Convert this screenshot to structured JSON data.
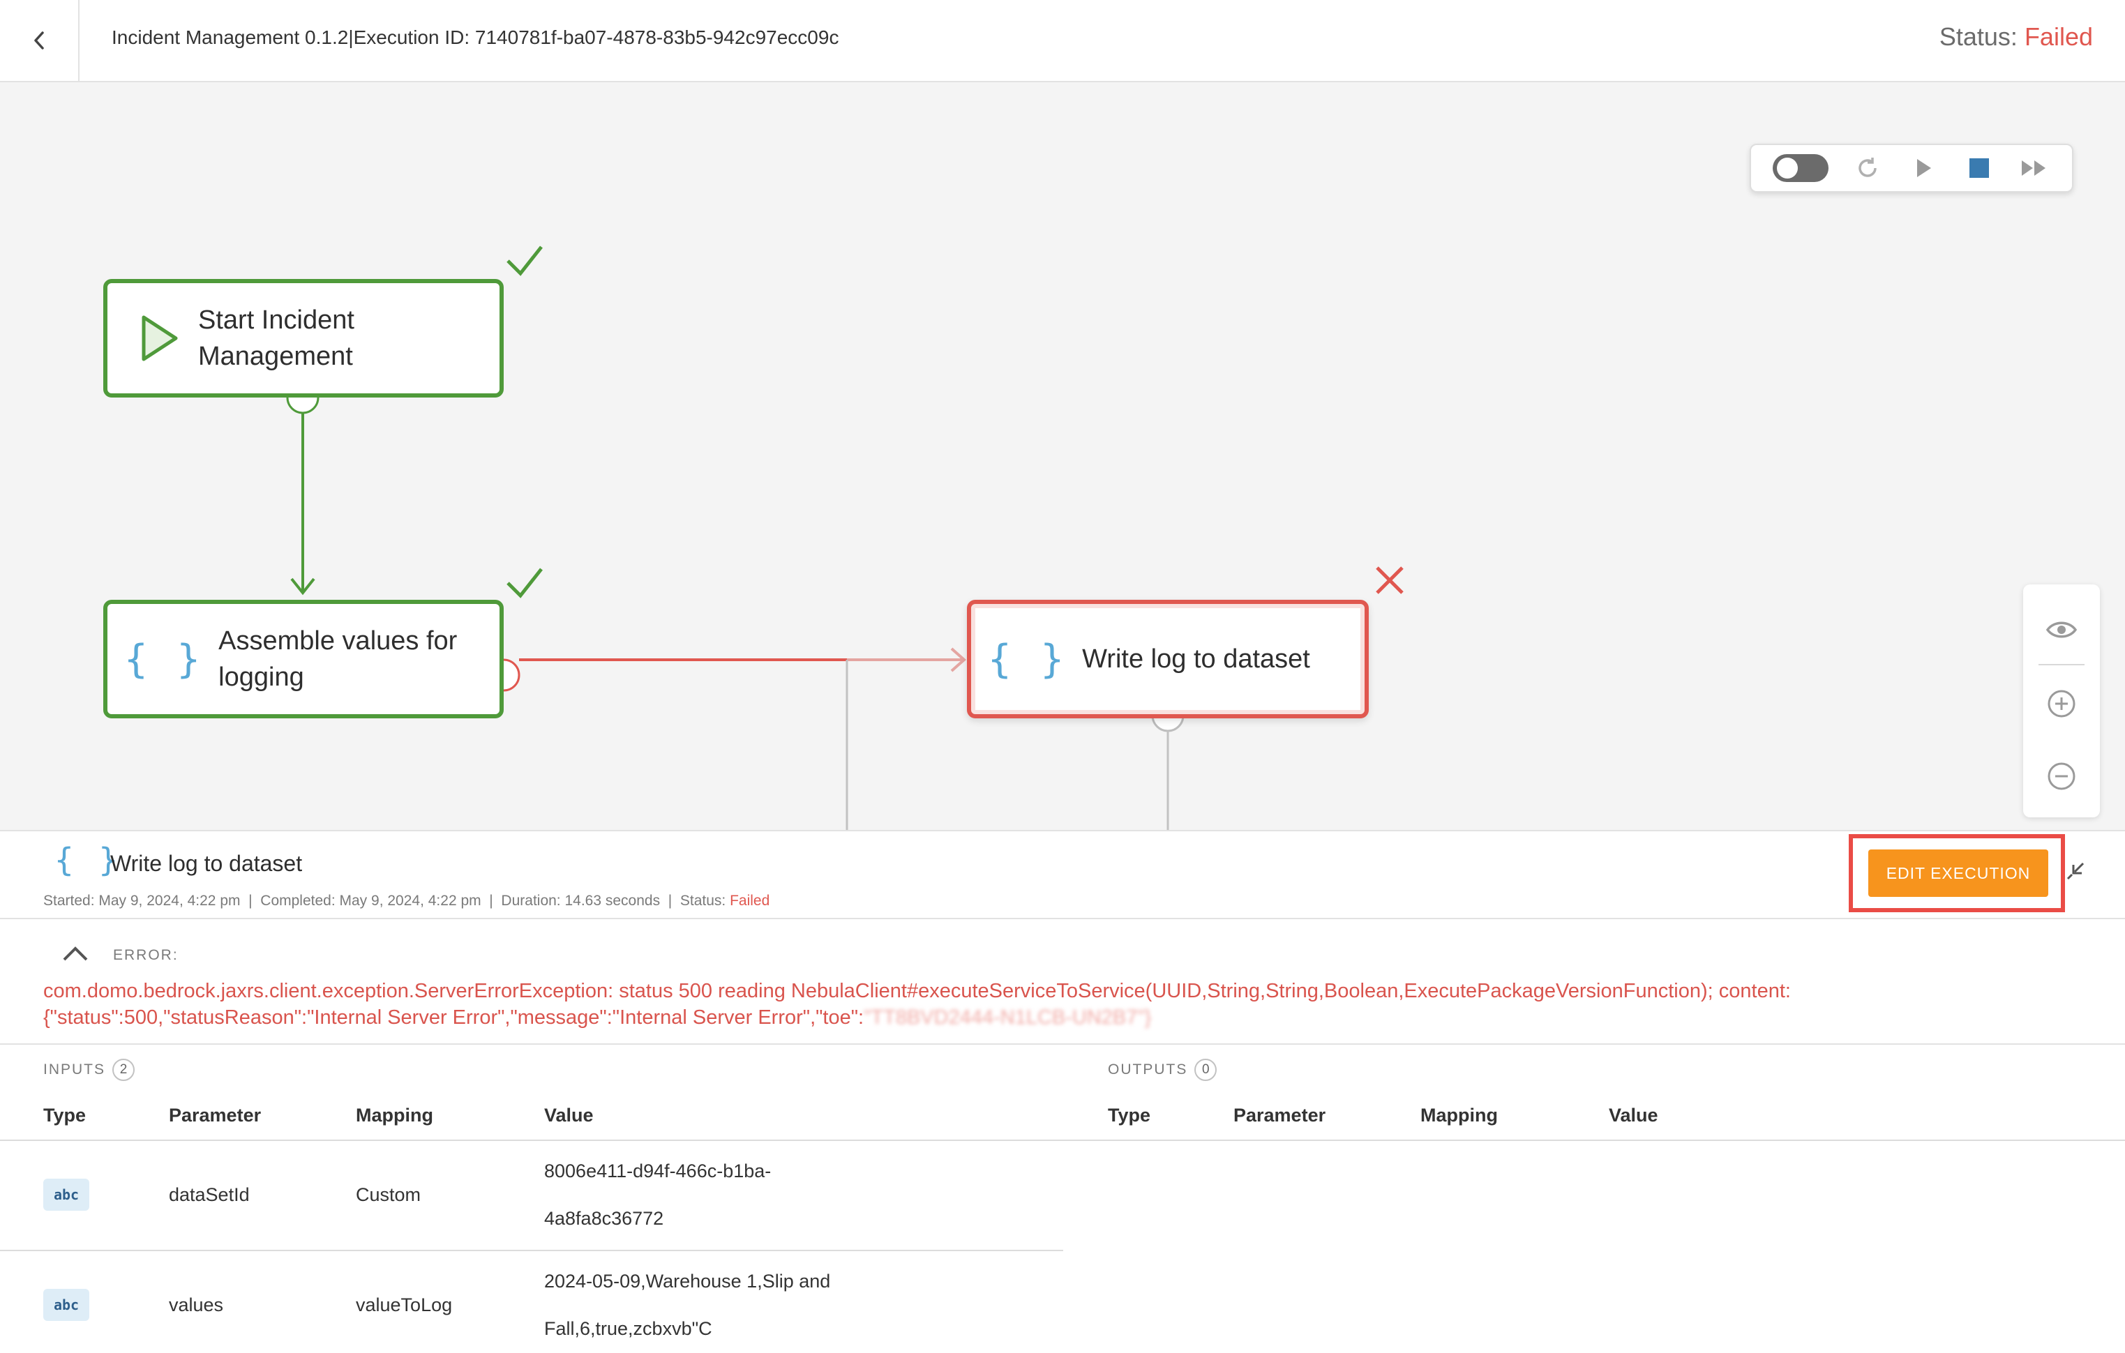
{
  "header": {
    "execution_title": "Incident Management 0.1.2|Execution ID: 7140781f-ba07-4878-83b5-942c97ecc09c",
    "status_label": "Status: ",
    "status_value": "Failed"
  },
  "toolbar": {
    "icons": [
      "toggle-switch",
      "refresh-icon",
      "play-icon",
      "stop-icon",
      "fast-forward-icon"
    ]
  },
  "workflow": {
    "nodes": [
      {
        "label": "Start Incident Management",
        "label_line1": "Start Incident",
        "label_line2": "Management",
        "icon": "play-icon",
        "status": "success"
      },
      {
        "label": "Assemble values for logging",
        "label_line1": "Assemble values for",
        "label_line2": "logging",
        "icon": "code-braces-icon",
        "status": "success"
      },
      {
        "label": "Write log to dataset",
        "icon": "code-braces-icon",
        "status": "failed"
      }
    ],
    "brace_glyph": "{ }"
  },
  "zoom_controls": {
    "icons": [
      "eye-icon",
      "zoom-in-icon",
      "zoom-out-icon"
    ]
  },
  "detail": {
    "title": "Write log to dataset",
    "meta_prefix": "Started: May 9, 2024, 4:22 pm  |  Completed: May 9, 2024, 4:22 pm  |  Duration: 14.63 seconds  |  Status: ",
    "meta_status": "Failed",
    "edit_button_label": "EDIT EXECUTION",
    "error_label": "ERROR:",
    "error_line1": "com.domo.bedrock.jaxrs.client.exception.ServerErrorException: status 500 reading NebulaClient#executeServiceToService(UUID,String,String,Boolean,ExecutePackageVersionFunction); content:",
    "error_line2": "{\"status\":500,\"statusReason\":\"Internal Server Error\",\"message\":\"Internal Server Error\",\"toe\":",
    "error_redacted": "\"TT8BVD2444-N1LCB-UN2B7\"}"
  },
  "inputs": {
    "label": "INPUTS",
    "count": "2",
    "columns": [
      "Type",
      "Parameter",
      "Mapping",
      "Value"
    ],
    "rows": [
      {
        "type": "abc",
        "parameter": "dataSetId",
        "mapping": "Custom",
        "value_line1": "8006e411-d94f-466c-b1ba-",
        "value_line2": "4a8fa8c36772"
      },
      {
        "type": "abc",
        "parameter": "values",
        "mapping": "valueToLog",
        "value_line1": "2024-05-09,Warehouse 1,Slip and",
        "value_line2": "Fall,6,true,zcbxvb\"C"
      }
    ]
  },
  "outputs": {
    "label": "OUTPUTS",
    "count": "0",
    "columns": [
      "Type",
      "Parameter",
      "Mapping",
      "Value"
    ]
  },
  "colors": {
    "success": "#4f9a3a",
    "failed": "#e0574f",
    "accent_orange": "#f7941d",
    "brace_blue": "#58a8d6",
    "stop_blue": "#3a7bb0"
  }
}
